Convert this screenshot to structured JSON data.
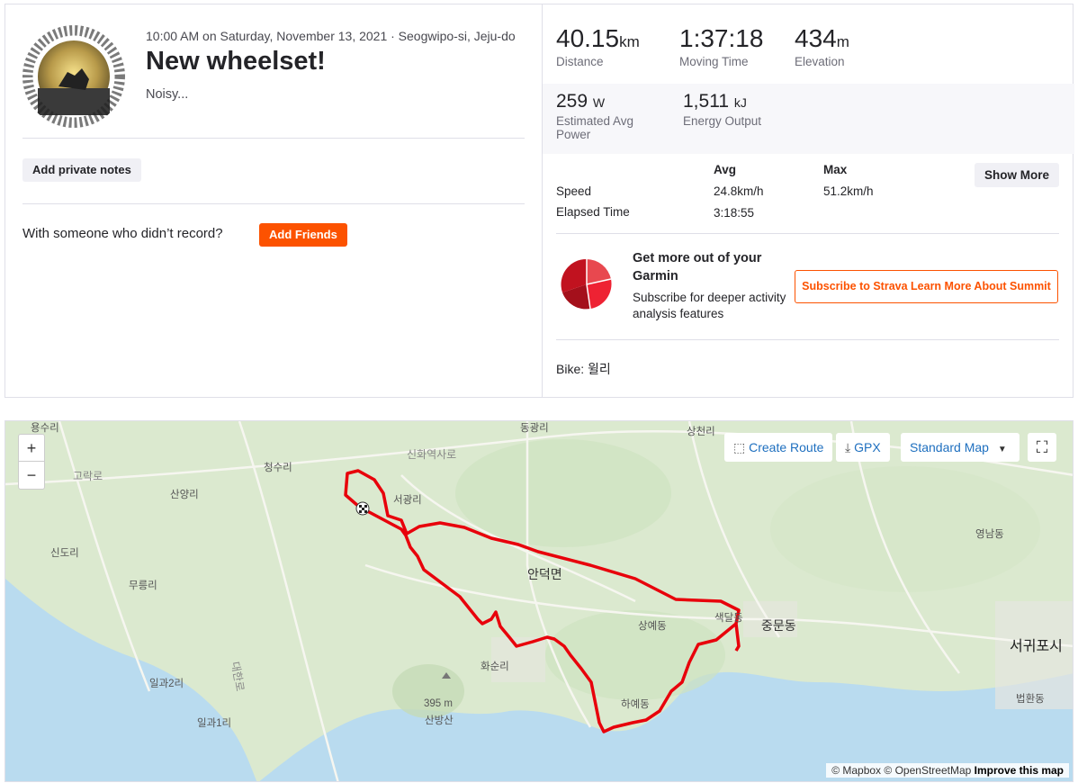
{
  "activity": {
    "meta": "10:00 AM on Saturday, November 13, 2021 · Seogwipo-si, Jeju-do",
    "title": "New wheelset!",
    "description": "Noisy...",
    "add_notes_label": "Add private notes",
    "with_someone_text": "With someone who didn’t record?",
    "add_friends_label": "Add Friends"
  },
  "stats": {
    "distance": {
      "value": "40.15",
      "unit": "km",
      "label": "Distance"
    },
    "moving_time": {
      "value": "1:37:18",
      "label": "Moving Time"
    },
    "elevation": {
      "value": "434",
      "unit": "m",
      "label": "Elevation"
    },
    "power": {
      "value": "259",
      "unit": "W",
      "label": "Estimated Avg Power"
    },
    "energy": {
      "value": "1,511",
      "unit": "kJ",
      "label": "Energy Output"
    }
  },
  "table": {
    "header_avg": "Avg",
    "header_max": "Max",
    "show_more_label": "Show More",
    "rows": [
      {
        "label": "Speed",
        "avg": "24.8km/h",
        "max": "51.2km/h"
      },
      {
        "label": "Elapsed Time",
        "avg": "3:18:55",
        "max": ""
      }
    ]
  },
  "promo": {
    "title": "Get more out of your Garmin",
    "subtitle": "Subscribe for deeper activity analysis features",
    "button_label": "Subscribe to Strava Learn More About Summit"
  },
  "bike": "Bike: 윌리",
  "map": {
    "zoom_in": "+",
    "zoom_out": "−",
    "create_route": "Create Route",
    "gpx": "GPX",
    "map_style": "Standard Map",
    "attribution_mapbox": "© Mapbox",
    "attribution_osm": "© OpenStreetMap",
    "improve": "Improve this map",
    "peak_elevation": "395 m",
    "places": {
      "yongsu": "용수리",
      "dongkwang": "동광리",
      "sangcheon": "상천리",
      "cheongsu": "청수리",
      "sinhwa_road": "신화역사로",
      "gorak_road": "고락로",
      "sanyang": "산양리",
      "seogwang": "서광리",
      "sindo": "신도리",
      "mureung": "무릉리",
      "andeok": "안덕면",
      "yeongnam": "영남동",
      "sangye": "상예동",
      "saekdal": "색달동",
      "jungmun": "중문동",
      "seogwipo": "서귀포시",
      "hwasun": "화순리",
      "ilgwa2": "일과2리",
      "daejeong_road": "대한로",
      "sanbangsan": "산방산",
      "haye": "하예동",
      "ilgwa1": "일과1리",
      "beophwan": "법환동"
    }
  }
}
